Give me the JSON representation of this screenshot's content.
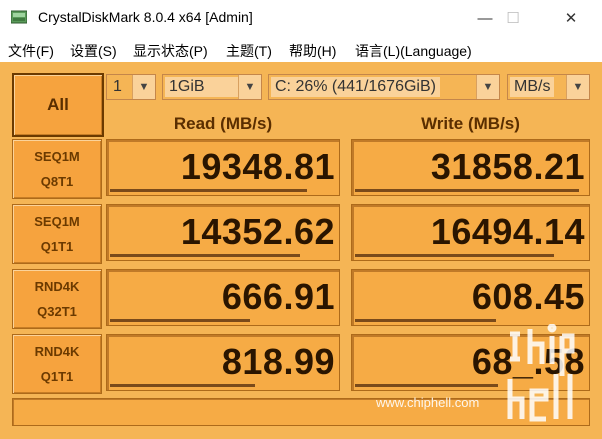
{
  "window": {
    "title": "CrystalDiskMark 8.0.4 x64 [Admin]",
    "minimize": "—",
    "maximize": "☐",
    "close": "✕"
  },
  "menu": [
    "文件(F)",
    "设置(S)",
    "显示状态(P)",
    "主题(T)",
    "帮助(H)",
    "语言(L)(Language)"
  ],
  "controls": {
    "all_label": "All",
    "count": "1",
    "size": "1GiB",
    "drive": "C: 26% (441/1676GiB)",
    "unit": "MB/s"
  },
  "headers": {
    "read": "Read (MB/s)",
    "write": "Write (MB/s)"
  },
  "rows": [
    {
      "line1": "SEQ1M",
      "line2": "Q8T1",
      "read": "19348.81",
      "write": "31858.21",
      "read_frac": 0.87,
      "write_frac": 0.97
    },
    {
      "line1": "SEQ1M",
      "line2": "Q1T1",
      "read": "14352.62",
      "write": "16494.14",
      "read_frac": 0.84,
      "write_frac": 0.86
    },
    {
      "line1": "RND4K",
      "line2": "Q32T1",
      "read": "666.91",
      "write": "608.45",
      "read_frac": 0.62,
      "write_frac": 0.61
    },
    {
      "line1": "RND4K",
      "line2": "Q1T1",
      "read": "818.99",
      "write": "68_.58",
      "read_frac": 0.64,
      "write_frac": 0.62
    }
  ],
  "watermark": {
    "url": "www.chiphell.com",
    "logo": "chiphell"
  },
  "colors": {
    "background": "#f5b555",
    "cell": "#f6ab45",
    "text": "#2a1500"
  }
}
